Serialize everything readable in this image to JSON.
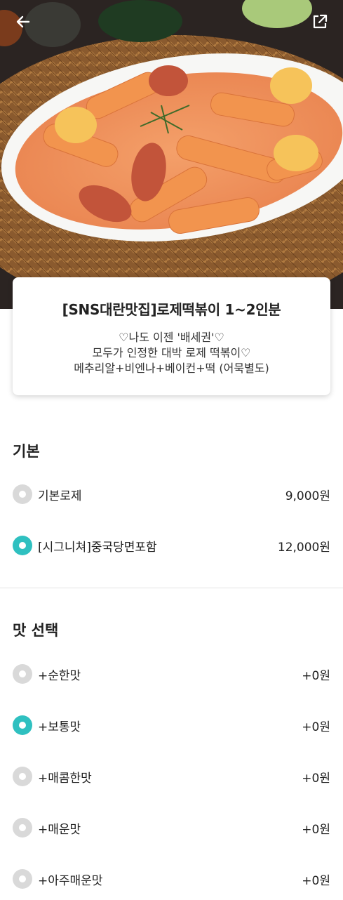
{
  "header": {
    "back_icon": "arrow-left-icon",
    "share_icon": "share-external-icon"
  },
  "product": {
    "title": "[SNS대란맛집]로제떡볶이 1~2인분",
    "desc_lines": [
      "♡나도 이젠 '배세권'♡",
      "모두가 인정한 대박 로제 떡볶이♡",
      "메추리알+비엔나+베이컨+떡 (어묵별도)"
    ]
  },
  "sections": [
    {
      "title": "기본",
      "options": [
        {
          "label": "기본로제",
          "price": "9,000원",
          "selected": false
        },
        {
          "label": "[시그니쳐]중국당면포함",
          "price": "12,000원",
          "selected": true
        }
      ]
    },
    {
      "title": "맛 선택",
      "options": [
        {
          "label": "+순한맛",
          "price": "+0원",
          "selected": false
        },
        {
          "label": "+보통맛",
          "price": "+0원",
          "selected": true
        },
        {
          "label": "+매콤한맛",
          "price": "+0원",
          "selected": false
        },
        {
          "label": "+매운맛",
          "price": "+0원",
          "selected": false
        },
        {
          "label": "+아주매운맛",
          "price": "+0원",
          "selected": false
        }
      ]
    }
  ],
  "colors": {
    "accent": "#2fc0c0",
    "radio_off": "#d9d9d9"
  }
}
